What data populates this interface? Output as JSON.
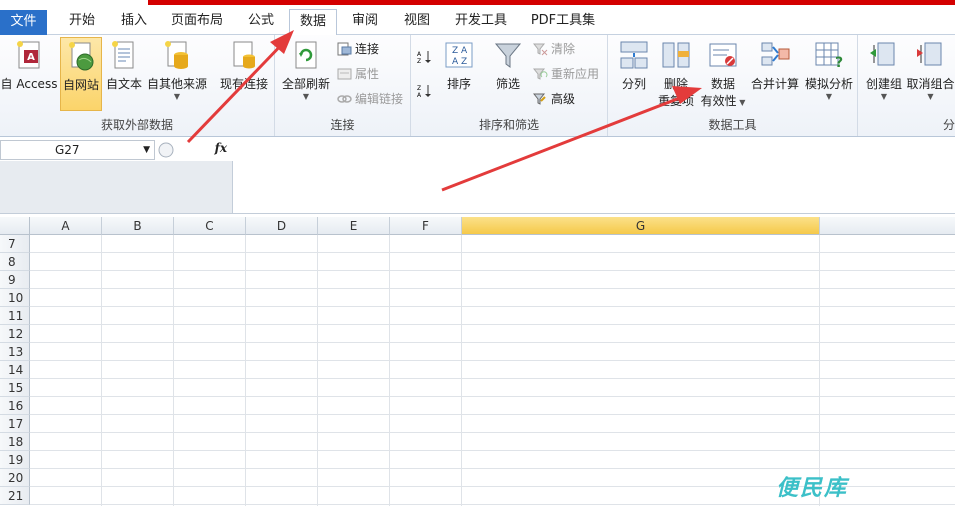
{
  "tabs": [
    {
      "label": "文件"
    },
    {
      "label": "开始"
    },
    {
      "label": "插入"
    },
    {
      "label": "页面布局"
    },
    {
      "label": "公式"
    },
    {
      "label": "数据"
    },
    {
      "label": "审阅"
    },
    {
      "label": "视图"
    },
    {
      "label": "开发工具"
    },
    {
      "label": "PDF工具集"
    }
  ],
  "ribbon": {
    "external": {
      "label": "获取外部数据",
      "access": "自 Access",
      "web": "自网站",
      "text": "自文本",
      "other": "自其他来源",
      "existing": "现有连接"
    },
    "connections": {
      "label": "连接",
      "refresh_all": "全部刷新",
      "connections": "连接",
      "properties": "属性",
      "edit_links": "编辑链接"
    },
    "sort_filter": {
      "label": "排序和筛选",
      "sort": "排序",
      "filter": "筛选",
      "clear": "清除",
      "reapply": "重新应用",
      "advanced": "高级"
    },
    "data_tools": {
      "label": "数据工具",
      "text_to_columns": "分列",
      "remove_dup_1": "删除",
      "remove_dup_2": "重复项",
      "validation_1": "数据",
      "validation_2": "有效性",
      "consolidate": "合并计算",
      "whatif": "模拟分析"
    },
    "outline": {
      "group": "创建组",
      "ungroup": "取消组合",
      "label_partial": "分"
    }
  },
  "formula_bar": {
    "name_box": "G27",
    "fx": "fx",
    "formula": ""
  },
  "columns": [
    "A",
    "B",
    "C",
    "D",
    "E",
    "F",
    "G"
  ],
  "selected_column": "G",
  "rows": [
    "7",
    "8",
    "9",
    "10",
    "11",
    "12",
    "13",
    "14",
    "15",
    "16",
    "17",
    "18",
    "19",
    "20",
    "21"
  ],
  "watermark": "便民库",
  "colors": {
    "file_tab": "#2a70c9",
    "selected_header": "#f5c94a",
    "arrow": "#e33b3b",
    "top_strip": "#d40000"
  }
}
